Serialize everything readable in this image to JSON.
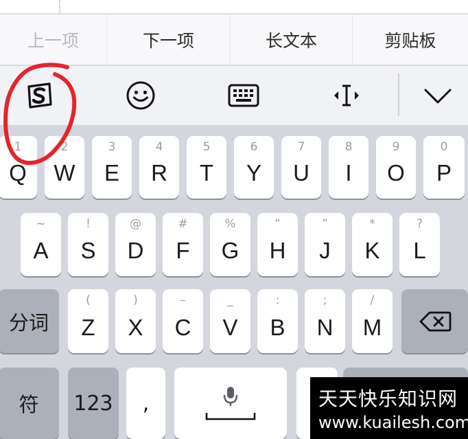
{
  "nav": {
    "items": [
      {
        "label": "上一项",
        "enabled": false
      },
      {
        "label": "下一项",
        "enabled": true
      },
      {
        "label": "长文本",
        "enabled": true
      },
      {
        "label": "剪贴板",
        "enabled": true
      }
    ]
  },
  "toolbar": {
    "icons": [
      "sogou-logo-icon",
      "emoji-icon",
      "keyboard-icon",
      "cursor-move-icon",
      "collapse-chevron-icon"
    ]
  },
  "keyboard": {
    "row1": [
      {
        "sub": "1",
        "main": "Q"
      },
      {
        "sub": "2",
        "main": "W"
      },
      {
        "sub": "3",
        "main": "E"
      },
      {
        "sub": "4",
        "main": "R"
      },
      {
        "sub": "5",
        "main": "T"
      },
      {
        "sub": "6",
        "main": "Y"
      },
      {
        "sub": "7",
        "main": "U"
      },
      {
        "sub": "8",
        "main": "I"
      },
      {
        "sub": "9",
        "main": "O"
      },
      {
        "sub": "0",
        "main": "P"
      }
    ],
    "row2": [
      {
        "sub": "~",
        "main": "A"
      },
      {
        "sub": "!",
        "main": "S"
      },
      {
        "sub": "@",
        "main": "D"
      },
      {
        "sub": "#",
        "main": "F"
      },
      {
        "sub": "%",
        "main": "G"
      },
      {
        "sub": "“",
        "main": "H"
      },
      {
        "sub": "”",
        "main": "J"
      },
      {
        "sub": "*",
        "main": "K"
      },
      {
        "sub": "?",
        "main": "L"
      }
    ],
    "row3": [
      {
        "sub": "(",
        "main": "Z"
      },
      {
        "sub": ")",
        "main": "X"
      },
      {
        "sub": "–",
        "main": "C"
      },
      {
        "sub": "_",
        "main": "V"
      },
      {
        "sub": ":",
        "main": "B"
      },
      {
        "sub": ";",
        "main": "N"
      },
      {
        "sub": "/",
        "main": "M"
      }
    ],
    "fenci_label": "分词",
    "fu_label": "符",
    "num_label": "123",
    "comma_label": ",",
    "delete_icon": "backspace-icon",
    "mic_icon": "microphone-icon"
  },
  "colors": {
    "annotation": "#e4242e",
    "key": "#ffffff",
    "key_dark": "#abb0ba",
    "background": "#d3d6dc"
  },
  "watermark": {
    "line1": "天天快乐知识网",
    "line2": "www.kuailesh.com"
  }
}
